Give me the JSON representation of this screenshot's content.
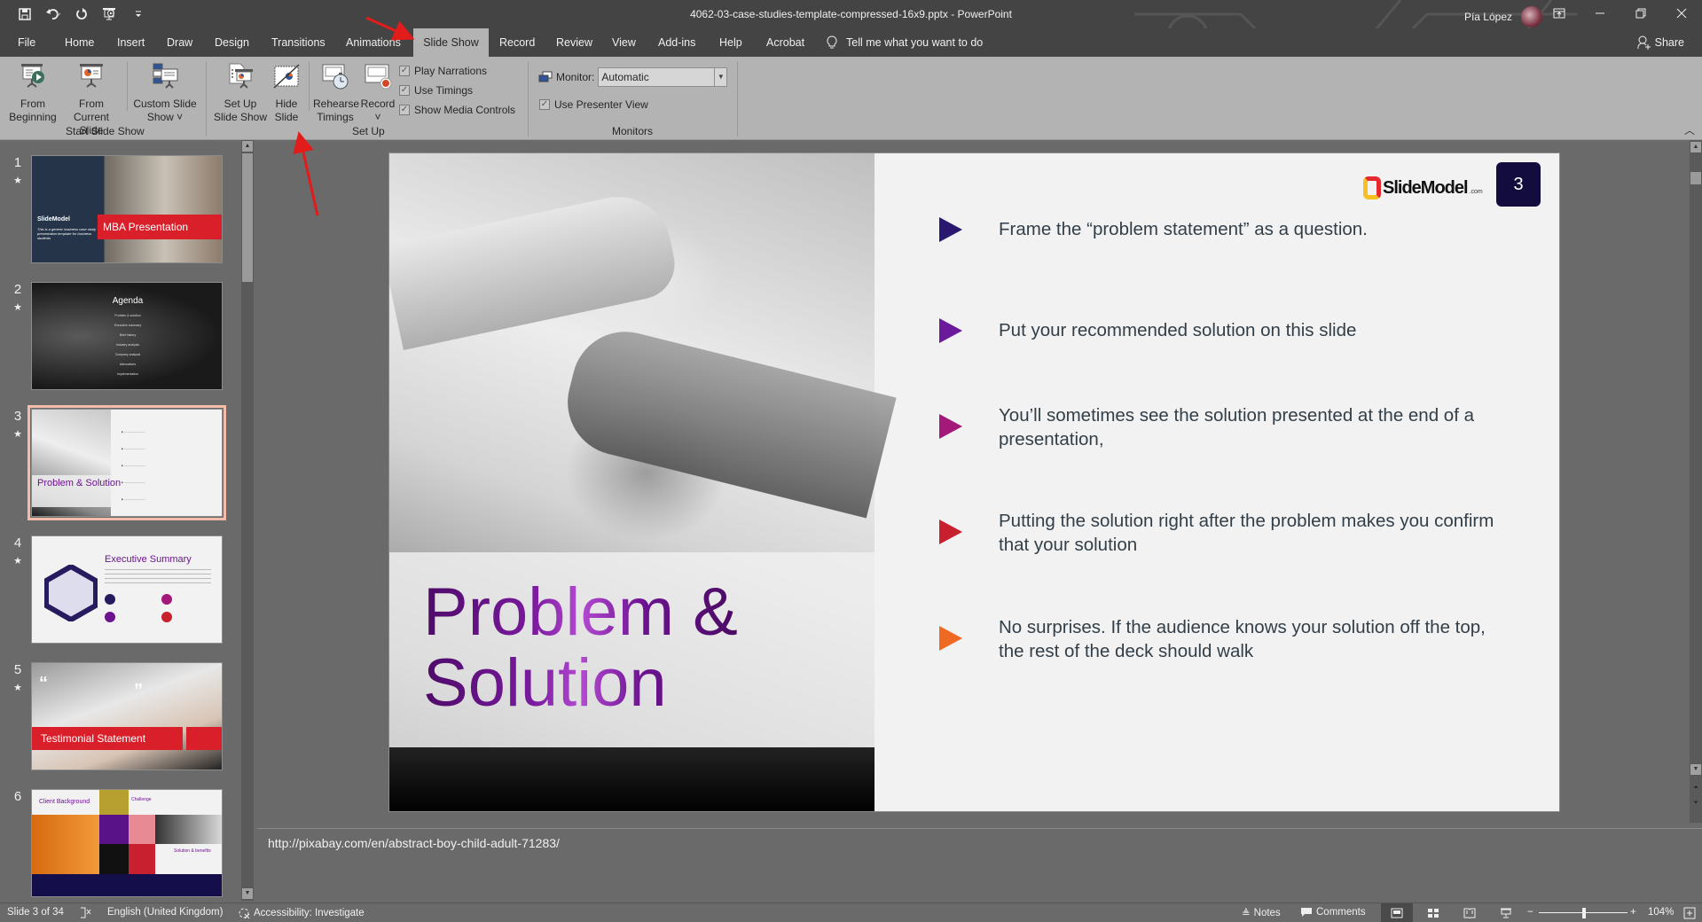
{
  "window": {
    "title": "4062-03-case-studies-template-compressed-16x9.pptx  -  PowerPoint",
    "user_name": "Pía López",
    "controls": [
      "ribbon-display-options",
      "minimize",
      "restore",
      "close"
    ]
  },
  "quick_access": {
    "icons": [
      "save-icon",
      "undo-icon",
      "redo-icon",
      "present-from-beginning-icon",
      "customize-qat-icon"
    ]
  },
  "tabs": [
    {
      "label": "File"
    },
    {
      "label": "Home"
    },
    {
      "label": "Insert"
    },
    {
      "label": "Draw"
    },
    {
      "label": "Design"
    },
    {
      "label": "Transitions"
    },
    {
      "label": "Animations"
    },
    {
      "label": "Slide Show",
      "active": true
    },
    {
      "label": "Record"
    },
    {
      "label": "Review"
    },
    {
      "label": "View"
    },
    {
      "label": "Add-ins"
    },
    {
      "label": "Help"
    },
    {
      "label": "Acrobat"
    }
  ],
  "tell_me": "Tell me what you want to do",
  "share_label": "Share",
  "ribbon": {
    "groups": {
      "start": "Start Slide Show",
      "setup": "Set Up",
      "monitors": "Monitors"
    },
    "buttons": {
      "from_beginning": [
        "From",
        "Beginning"
      ],
      "from_current": [
        "From",
        "Current Slide"
      ],
      "custom_show": [
        "Custom Slide",
        "Show ˅"
      ],
      "setup_show": [
        "Set Up",
        "Slide Show"
      ],
      "hide_slide": [
        "Hide",
        "Slide"
      ],
      "rehearse": [
        "Rehearse",
        "Timings"
      ],
      "record": [
        "Record",
        "˅"
      ]
    },
    "checkboxes": [
      {
        "label": "Play Narrations",
        "checked": true
      },
      {
        "label": "Use Timings",
        "checked": true
      },
      {
        "label": "Show Media Controls",
        "checked": true
      }
    ],
    "monitor_label": "Monitor:",
    "monitor_value": "Automatic",
    "presenter_view": {
      "label": "Use Presenter View",
      "checked": true
    }
  },
  "thumbnails": [
    {
      "num": "1",
      "star": "★",
      "title": "MBA Presentation",
      "subtitle": "This is a generic business case study presentation template for business students"
    },
    {
      "num": "2",
      "star": "★",
      "title": "Agenda",
      "items": [
        "Problem & solution",
        "Executive summary",
        "Brief history",
        "Industry analysis",
        "Company analysis",
        "Alternatives",
        "Implementation"
      ]
    },
    {
      "num": "3",
      "star": "★",
      "title": "Problem & Solution",
      "selected": true
    },
    {
      "num": "4",
      "star": "★",
      "title": "Executive Summary"
    },
    {
      "num": "5",
      "star": "★",
      "title": "Testimonial Statement"
    },
    {
      "num": "6",
      "star": "",
      "title": "Client Background",
      "labels": [
        "Challenge",
        "Solution & benefits"
      ]
    }
  ],
  "slide": {
    "title_line1": "Problem &",
    "title_line2": "Solution",
    "logo": "SlideModel",
    "logo_suffix": ".com",
    "page_number": "3",
    "bullets": [
      {
        "text": "Frame the “problem statement” as a question.",
        "color": "#2a1870"
      },
      {
        "text": "Put your recommended solution on this slide",
        "color": "#6a1a9a"
      },
      {
        "text": "You’ll sometimes see the solution presented at the end of a presentation,",
        "color": "#a3197a"
      },
      {
        "text": "Putting the solution right after the problem makes you confirm that your solution",
        "color": "#c8202f"
      },
      {
        "text": "No surprises. If the audience knows your solution off the top, the rest of the deck should walk",
        "color": "#ee6a24"
      }
    ]
  },
  "notes": "http://pixabay.com/en/abstract-boy-child-adult-71283/",
  "status": {
    "slide_info": "Slide 3 of 34",
    "language": "English (United Kingdom)",
    "accessibility": "Accessibility: Investigate",
    "notes_label": "Notes",
    "comments_label": "Comments",
    "zoom": "104%",
    "zoom_percent": 104
  }
}
